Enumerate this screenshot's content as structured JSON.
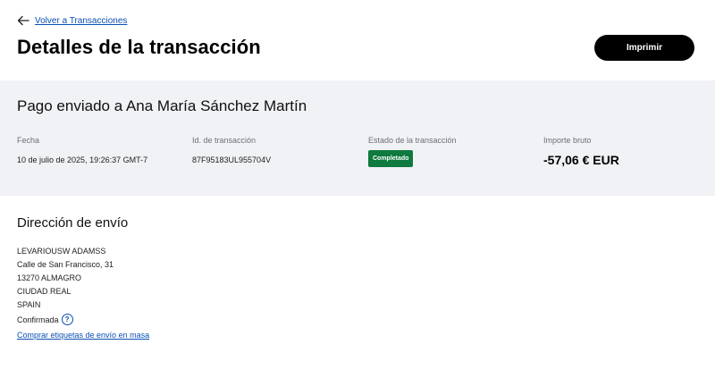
{
  "header": {
    "back_label": "Volver a Transacciones",
    "title": "Detalles de la transacción",
    "print_label": "Imprimir"
  },
  "summary": {
    "title": "Pago enviado a Ana María Sánchez Martín",
    "date_label": "Fecha",
    "date_value": "10 de julio de 2025, 19:26:37 GMT-7",
    "txid_label": "Id. de transacción",
    "txid_value": "87F95183UL955704V",
    "status_label": "Estado de la transacción",
    "status_value": "Completado",
    "amount_label": "Importe bruto",
    "amount_value": "-57,06 € EUR"
  },
  "shipping": {
    "title": "Dirección de envío",
    "lines": [
      "LEVARIOUSW ADAMSS",
      "Calle de San Francisco, 31",
      "13270 ALMAGRO",
      "CIUDAD REAL",
      "SPAIN"
    ],
    "confirmed_label": "Confirmada",
    "help_icon": "question-circle-icon",
    "bulk_labels_link": "Comprar etiquetas de envío en masa"
  },
  "colors": {
    "link": "#0a4fb3",
    "status_green": "#0e7a3e",
    "summary_bg": "#f1f2f5"
  }
}
